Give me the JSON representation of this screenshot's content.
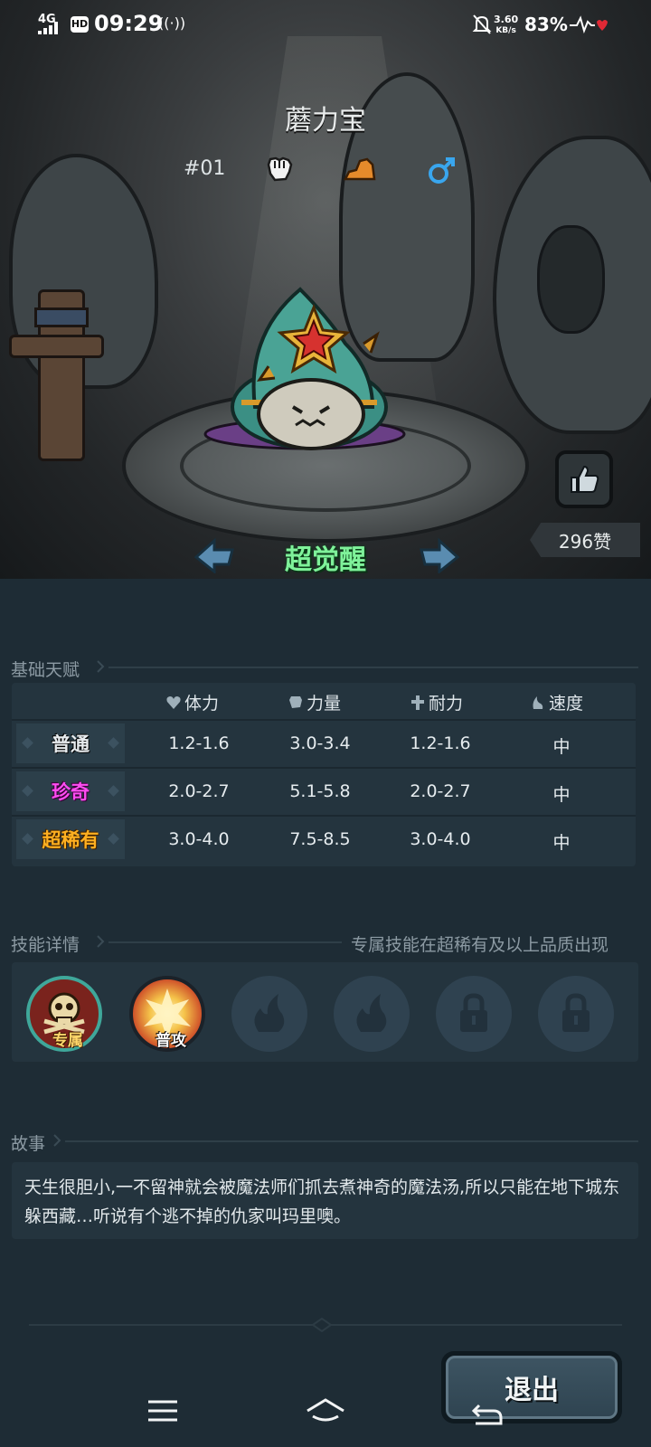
{
  "status_bar": {
    "network": "4G",
    "hd": "HD",
    "time": "09:29",
    "hotspot": "((·))",
    "speed_value": "3.60",
    "speed_unit": "KB/s",
    "battery": "83%"
  },
  "pet": {
    "name": "蘑力宝",
    "number": "#01",
    "icons": [
      "fist-icon",
      "terrain-icon",
      "male-icon"
    ],
    "likes": "296赞",
    "awaken_label": "超觉醒"
  },
  "talent": {
    "title": "基础天赋",
    "columns": [
      "体力",
      "力量",
      "耐力",
      "速度"
    ],
    "rows": [
      {
        "rarity": "普通",
        "values": [
          "1.2-1.6",
          "3.0-3.4",
          "1.2-1.6",
          "中"
        ]
      },
      {
        "rarity": "珍奇",
        "values": [
          "2.0-2.7",
          "5.1-5.8",
          "2.0-2.7",
          "中"
        ]
      },
      {
        "rarity": "超稀有",
        "values": [
          "3.0-4.0",
          "7.5-8.5",
          "3.0-4.0",
          "中"
        ]
      }
    ]
  },
  "skills": {
    "title": "技能详情",
    "note": "专属技能在超稀有及以上品质出现",
    "items": [
      {
        "label": "专属",
        "icon": "skull-icon"
      },
      {
        "label": "普攻",
        "icon": "explosion-icon"
      },
      {
        "label": "",
        "icon": "flame-icon"
      },
      {
        "label": "",
        "icon": "flame-icon"
      },
      {
        "label": "",
        "icon": "lock-icon"
      },
      {
        "label": "",
        "icon": "lock-icon"
      }
    ]
  },
  "story": {
    "title": "故事",
    "text": "天生很胆小,一不留神就会被魔法师们抓去煮神奇的魔法汤,所以只能在地下城东躲西藏…听说有个逃不掉的仇家叫玛里噢。"
  },
  "exit_label": "退出",
  "colors": {
    "awaken": "#7ff29a",
    "rarity_common": "#e8ecef",
    "rarity_rare": "#ff4df2",
    "rarity_super": "#ffb021",
    "panel_bg": "#1e2c35"
  }
}
